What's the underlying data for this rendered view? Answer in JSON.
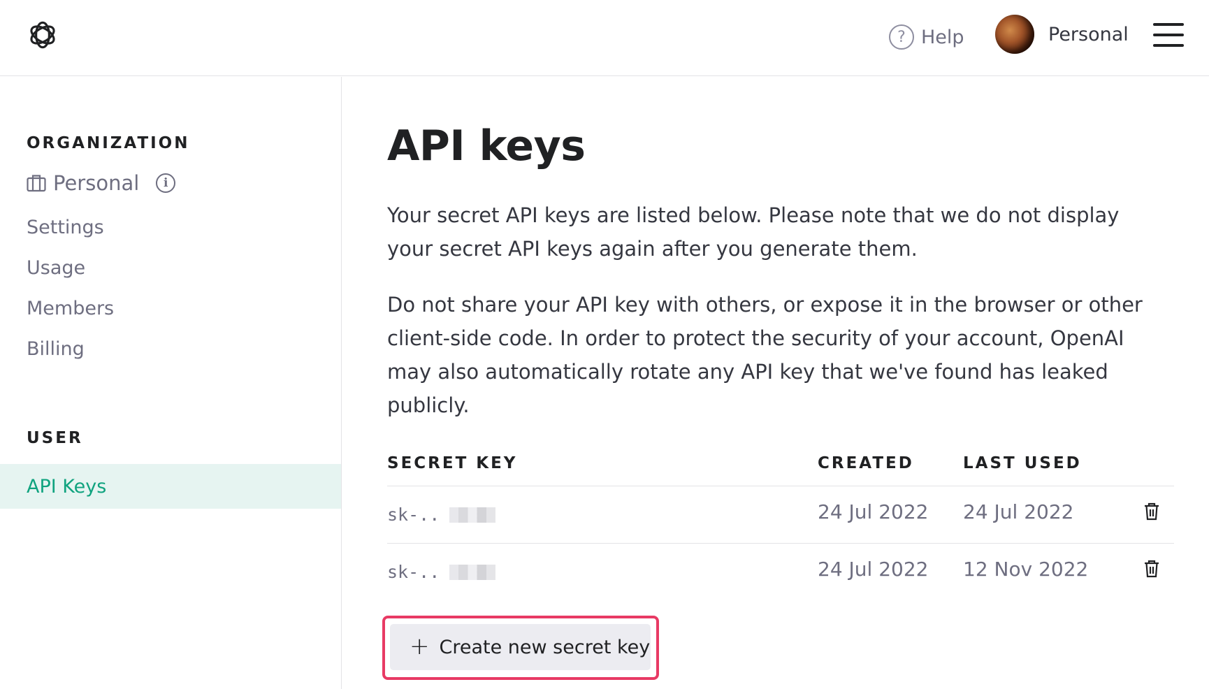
{
  "header": {
    "logo": "openai-logo",
    "help_label": "Help",
    "help_icon": "question-circle-icon",
    "account_name": "Personal",
    "menu_icon": "hamburger-menu-icon"
  },
  "sidebar": {
    "organization_label": "ORGANIZATION",
    "org_name": "Personal",
    "org_icon": "briefcase-icon",
    "items": [
      "Settings",
      "Usage",
      "Members",
      "Billing"
    ],
    "user_label": "USER",
    "active_item": "API Keys"
  },
  "main": {
    "title": "API keys",
    "paragraph1": "Your secret API keys are listed below. Please note that we do not display your secret API keys again after you generate them.",
    "paragraph2": "Do not share your API key with others, or expose it in the browser or other client-side code. In order to protect the security of your account, OpenAI may also automatically rotate any API key that we've found has leaked publicly.",
    "table": {
      "headers": {
        "key": "SECRET KEY",
        "created": "CREATED",
        "last_used": "LAST USED"
      },
      "rows": [
        {
          "key": "sk-..",
          "created": "24 Jul 2022",
          "last_used": "24 Jul 2022"
        },
        {
          "key": "sk-..",
          "created": "24 Jul 2022",
          "last_used": "12 Nov 2022"
        }
      ]
    },
    "create_button": {
      "icon": "+",
      "label": "Create new secret key"
    }
  },
  "colors": {
    "accent": "#10a37f",
    "active_bg": "#e6f4f1",
    "highlight_border": "#e83a64",
    "muted_text": "#6e6e80"
  }
}
